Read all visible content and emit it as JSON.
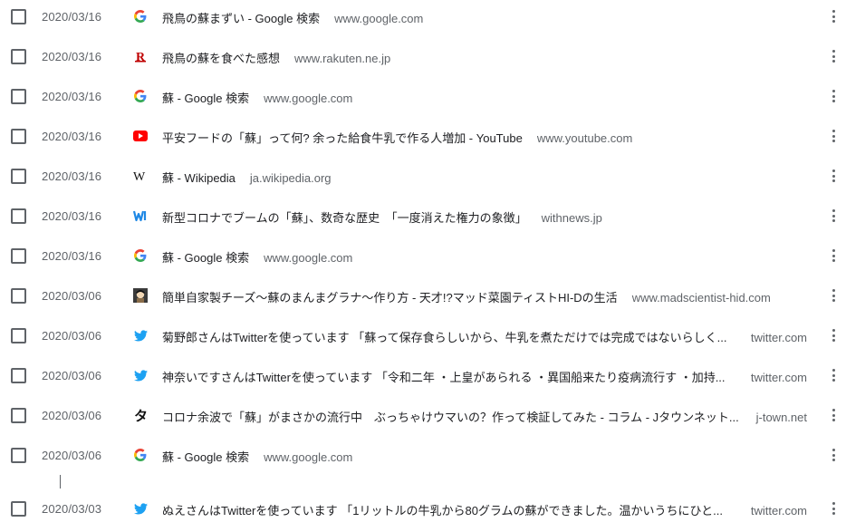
{
  "history": {
    "items": [
      {
        "date": "2020/03/16",
        "icon": "google-icon",
        "title": "飛鳥の蘇まずい - Google 検索",
        "domain": "www.google.com"
      },
      {
        "date": "2020/03/16",
        "icon": "rakuten-icon",
        "title": "飛鳥の蘇を食べた感想",
        "domain": "www.rakuten.ne.jp"
      },
      {
        "date": "2020/03/16",
        "icon": "google-icon",
        "title": "蘇 - Google 検索",
        "domain": "www.google.com"
      },
      {
        "date": "2020/03/16",
        "icon": "youtube-icon",
        "title": "平安フードの「蘇」って何? 余った給食牛乳で作る人増加 - YouTube",
        "domain": "www.youtube.com"
      },
      {
        "date": "2020/03/16",
        "icon": "wikipedia-icon",
        "title": "蘇 - Wikipedia",
        "domain": "ja.wikipedia.org"
      },
      {
        "date": "2020/03/16",
        "icon": "withnews-icon",
        "title": "新型コロナでブームの「蘇」、数奇な歴史　「一度消えた権力の象徴」",
        "domain": "withnews.jp"
      },
      {
        "date": "2020/03/16",
        "icon": "google-icon",
        "title": "蘇 - Google 検索",
        "domain": "www.google.com"
      },
      {
        "date": "2020/03/06",
        "icon": "madscientist-icon",
        "title": "簡単自家製チーズ～蘇のまんまグラナ～作り方 - 天才!?マッド菜園ティストHI-Dの生活",
        "domain": "www.madscientist-hid.com"
      },
      {
        "date": "2020/03/06",
        "icon": "twitter-icon",
        "title": "菊野郎さんはTwitterを使っています 「蘇って保存食らしいから、牛乳を煮ただけでは完成ではないらしく...",
        "domain": "twitter.com"
      },
      {
        "date": "2020/03/06",
        "icon": "twitter-icon",
        "title": "神奈いですさんはTwitterを使っています 「令和二年 ・上皇があられる ・異国船来たり疫病流行す ・加持...",
        "domain": "twitter.com"
      },
      {
        "date": "2020/03/06",
        "icon": "jtown-icon",
        "title": "コロナ余波で「蘇」がまさかの流行中　ぶっちゃけウマいの？作って検証してみた - コラム - Jタウンネット...",
        "domain": "j-town.net"
      },
      {
        "date": "2020/03/06",
        "icon": "google-icon",
        "title": "蘇 - Google 検索",
        "domain": "www.google.com"
      },
      {
        "date": "2020/03/03",
        "icon": "twitter-icon",
        "title": "ぬえさんはTwitterを使っています 「1リットルの牛乳から80グラムの蘇ができました。温かいうちにひと...",
        "domain": "twitter.com"
      }
    ]
  }
}
